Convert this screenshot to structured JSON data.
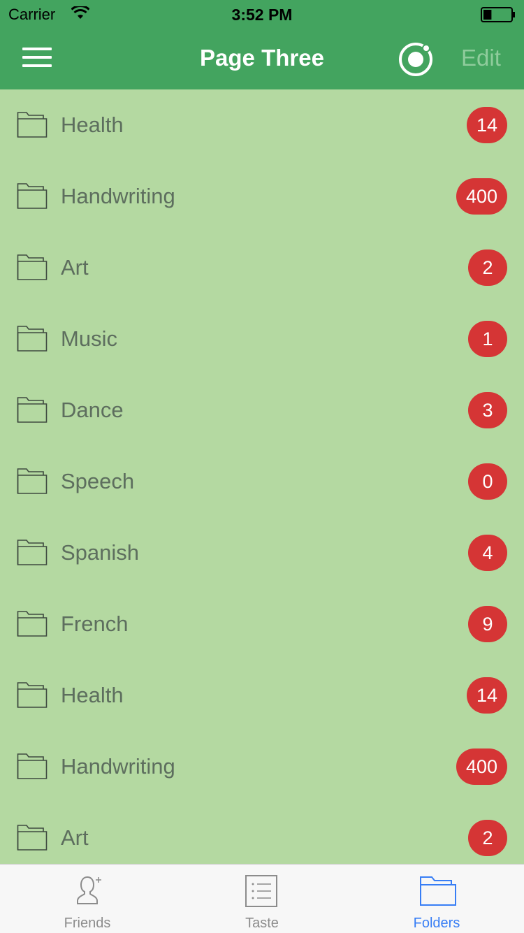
{
  "status_bar": {
    "carrier": "Carrier",
    "time": "3:52 PM",
    "battery_level": 0.3
  },
  "nav": {
    "title": "Page Three",
    "edit_label": "Edit",
    "menu_icon": "hamburger-menu-icon",
    "ionic_icon": "ionic-logo-icon"
  },
  "list": {
    "items": [
      {
        "label": "Health",
        "badge": "14"
      },
      {
        "label": "Handwriting",
        "badge": "400"
      },
      {
        "label": "Art",
        "badge": "2"
      },
      {
        "label": "Music",
        "badge": "1"
      },
      {
        "label": "Dance",
        "badge": "3"
      },
      {
        "label": "Speech",
        "badge": "0"
      },
      {
        "label": "Spanish",
        "badge": "4"
      },
      {
        "label": "French",
        "badge": "9"
      },
      {
        "label": "Health",
        "badge": "14"
      },
      {
        "label": "Handwriting",
        "badge": "400"
      },
      {
        "label": "Art",
        "badge": "2"
      }
    ]
  },
  "tabs": [
    {
      "label": "Friends",
      "icon": "add-person-icon",
      "active": false
    },
    {
      "label": "Taste",
      "icon": "list-icon",
      "active": false
    },
    {
      "label": "Folders",
      "icon": "folder-icon",
      "active": true
    }
  ],
  "colors": {
    "header": "#43a45f",
    "list_background": "#b4d9a1",
    "badge": "#d53535",
    "tab_active": "#387ef5",
    "tab_inactive": "#8c8c8c"
  }
}
